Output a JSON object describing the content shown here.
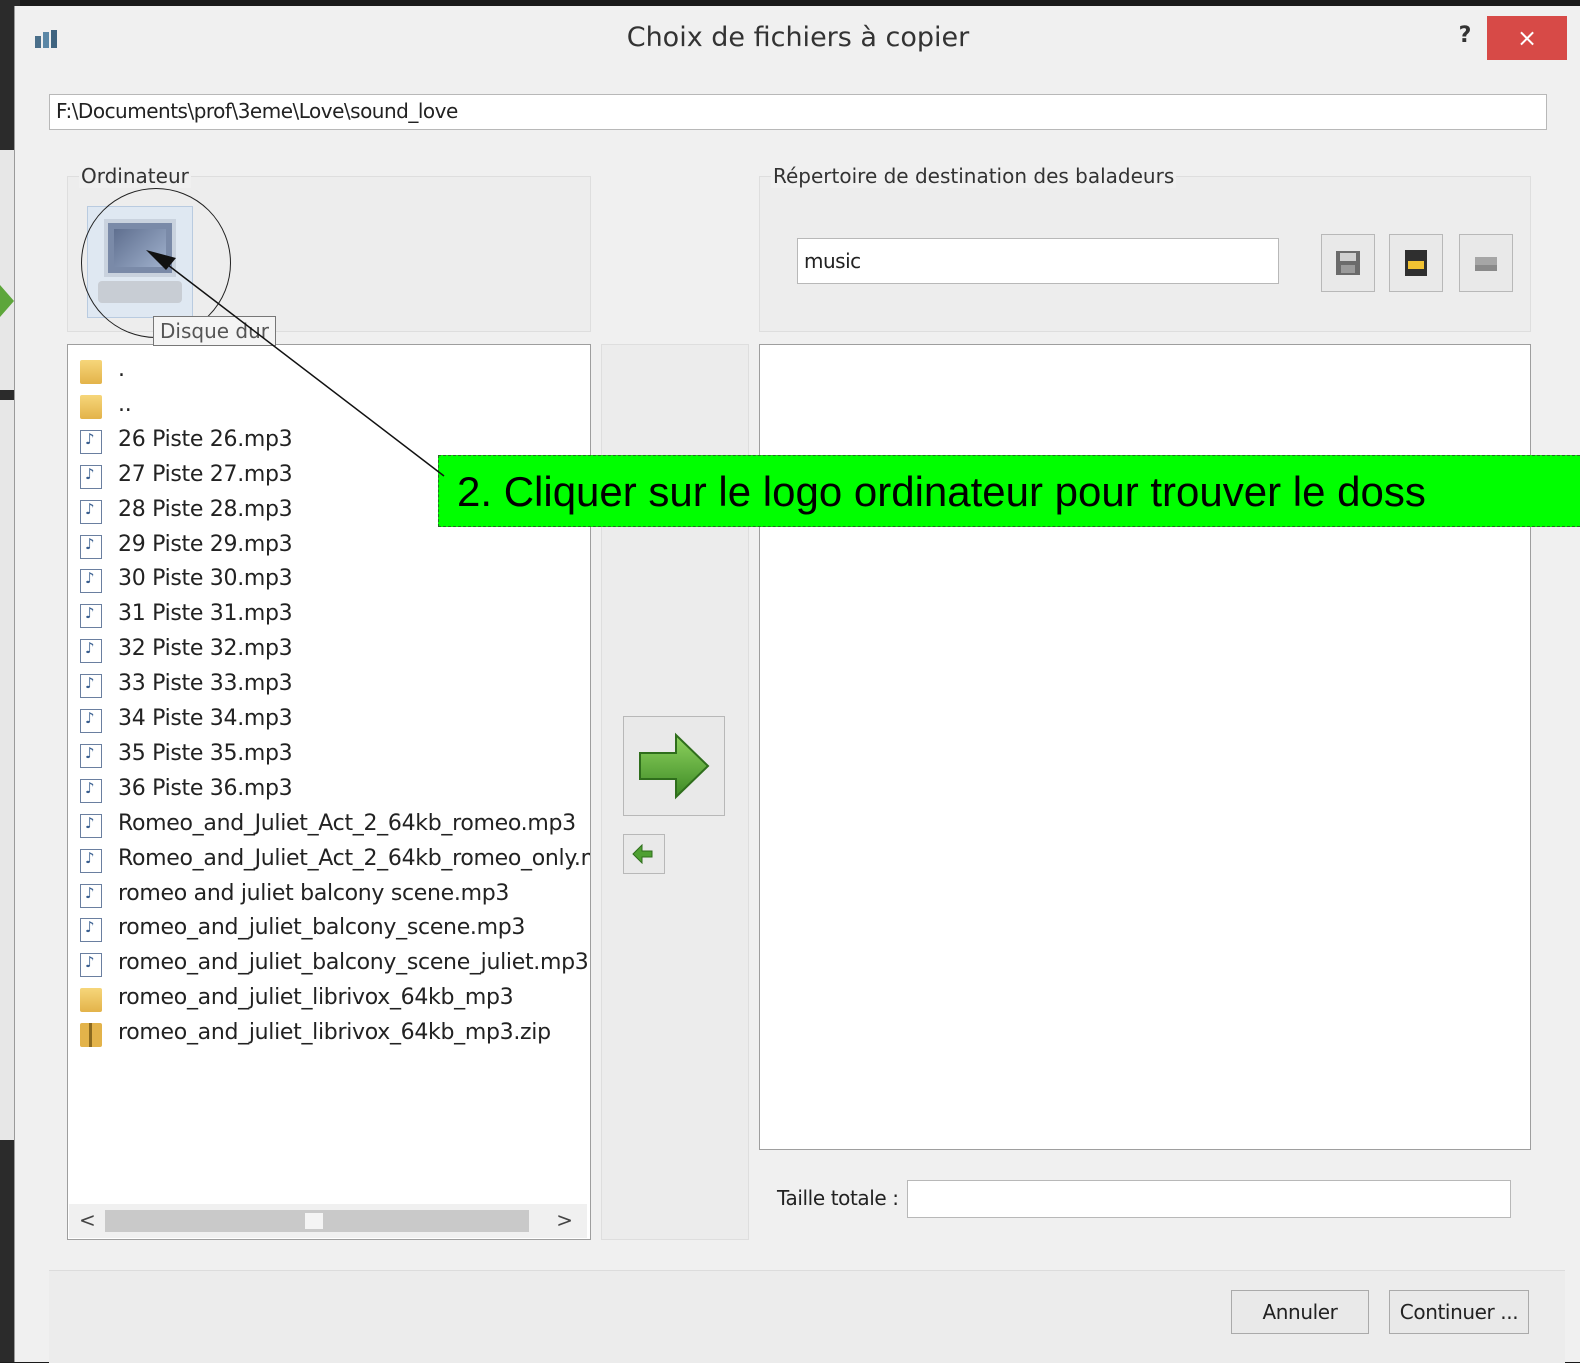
{
  "window": {
    "title": "Choix de fichiers à copier",
    "help_label": "?",
    "close_label": "×"
  },
  "path": {
    "value": "F:\\Documents\\prof\\3eme\\Love\\sound_love"
  },
  "source_group": {
    "label": "Ordinateur",
    "tooltip": "Disque dur",
    "files": [
      {
        "name": ".",
        "icon": "folder-icon"
      },
      {
        "name": "..",
        "icon": "folder-icon"
      },
      {
        "name": "26 Piste 26.mp3",
        "icon": "audio-file-icon"
      },
      {
        "name": "27 Piste 27.mp3",
        "icon": "audio-file-icon"
      },
      {
        "name": "28 Piste 28.mp3",
        "icon": "audio-file-icon"
      },
      {
        "name": "29 Piste 29.mp3",
        "icon": "audio-file-icon"
      },
      {
        "name": "30 Piste 30.mp3",
        "icon": "audio-file-icon"
      },
      {
        "name": "31 Piste 31.mp3",
        "icon": "audio-file-icon"
      },
      {
        "name": "32 Piste 32.mp3",
        "icon": "audio-file-icon"
      },
      {
        "name": "33 Piste 33.mp3",
        "icon": "audio-file-icon"
      },
      {
        "name": "34 Piste 34.mp3",
        "icon": "audio-file-icon"
      },
      {
        "name": "35 Piste 35.mp3",
        "icon": "audio-file-icon"
      },
      {
        "name": "36 Piste 36.mp3",
        "icon": "audio-file-icon"
      },
      {
        "name": "Romeo_and_Juliet_Act_2_64kb_romeo.mp3",
        "icon": "audio-file-icon"
      },
      {
        "name": "Romeo_and_Juliet_Act_2_64kb_romeo_only.m",
        "icon": "audio-file-icon"
      },
      {
        "name": "romeo and juliet balcony scene.mp3",
        "icon": "audio-file-icon"
      },
      {
        "name": "romeo_and_juliet_balcony_scene.mp3",
        "icon": "audio-file-icon"
      },
      {
        "name": "romeo_and_juliet_balcony_scene_juliet.mp3",
        "icon": "audio-file-icon"
      },
      {
        "name": "romeo_and_juliet_librivox_64kb_mp3",
        "icon": "folder-icon"
      },
      {
        "name": "romeo_and_juliet_librivox_64kb_mp3.zip",
        "icon": "zip-folder-icon"
      }
    ],
    "scroll_left": "<",
    "scroll_right": ">"
  },
  "destination_group": {
    "label": "Répertoire de destination des baladeurs",
    "folder_value": "music",
    "buttons": [
      "save-icon",
      "sd-card-icon",
      "drive-icon"
    ]
  },
  "total_size": {
    "label": "Taille totale :",
    "value": ""
  },
  "buttons": {
    "cancel": "Annuler",
    "continue": "Continuer ..."
  },
  "annotation": {
    "text": "2. Cliquer sur le logo ordinateur pour trouver le doss"
  },
  "colors": {
    "annotation_bg": "#00ff00",
    "close_button": "#d74a47",
    "arrow_green": "#5da63a"
  }
}
